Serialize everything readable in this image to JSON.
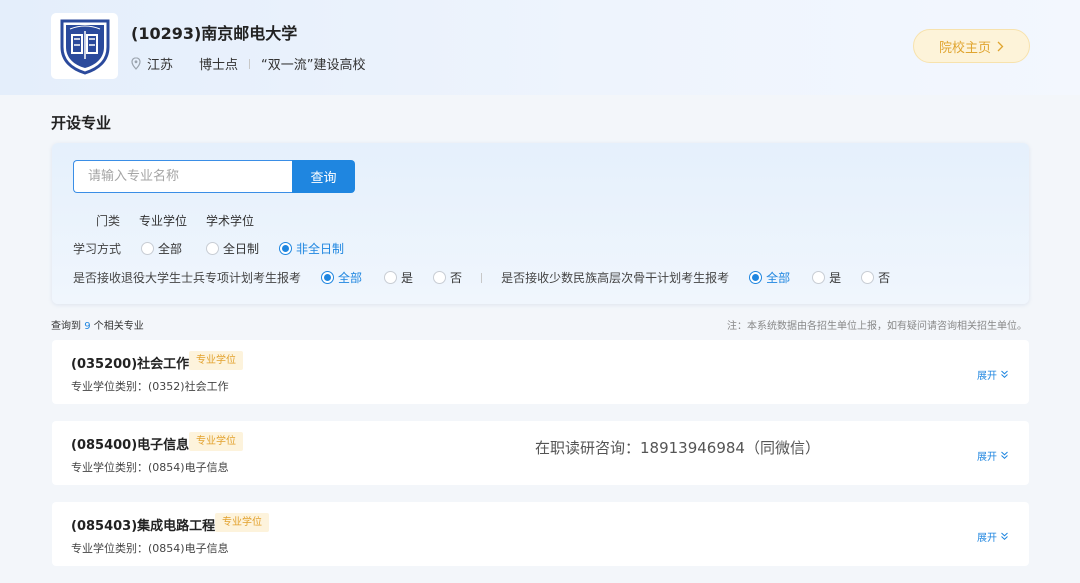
{
  "school": {
    "name": "(10293)南京邮电大学",
    "location": "江苏",
    "tags": [
      "博士点",
      "“双一流”建设高校"
    ],
    "home_button": "院校主页"
  },
  "section_title": "开设专业",
  "search": {
    "placeholder": "请输入专业名称",
    "button": "查询"
  },
  "filters": {
    "category": {
      "label": "门类",
      "options": [
        "专业学位",
        "学术学位"
      ]
    },
    "study_mode": {
      "label": "学习方式",
      "options": [
        "全部",
        "全日制",
        "非全日制"
      ],
      "selected": "非全日制"
    },
    "veteran_plan": {
      "label": "是否接收退役大学生士兵专项计划考生报考",
      "options": [
        "全部",
        "是",
        "否"
      ],
      "selected": "全部"
    },
    "minority_plan": {
      "label": "是否接收少数民族高层次骨干计划考生报考",
      "options": [
        "全部",
        "是",
        "否"
      ],
      "selected": "全部"
    }
  },
  "results": {
    "prefix": "查询到",
    "count": "9",
    "suffix": "个相关专业",
    "note": "注：本系统数据由各招生单位上报，如有疑问请咨询相关招生单位。"
  },
  "programs": [
    {
      "name": "(035200)社会工作",
      "tag": "专业学位",
      "category": "专业学位类别：(0352)社会工作",
      "expand": "展开"
    },
    {
      "name": "(085400)电子信息",
      "tag": "专业学位",
      "category": "专业学位类别：(0854)电子信息",
      "expand": "展开"
    },
    {
      "name": "(085403)集成电路工程",
      "tag": "专业学位",
      "category": "专业学位类别：(0854)电子信息",
      "expand": "展开"
    }
  ],
  "watermark": "在职读研咨询：18913946984（同微信）",
  "colors": {
    "accent": "#1f86e0",
    "tag_text": "#e2a12c",
    "tag_bg": "#fdf3dc",
    "home_btn_bg": "#fdf3d9"
  }
}
